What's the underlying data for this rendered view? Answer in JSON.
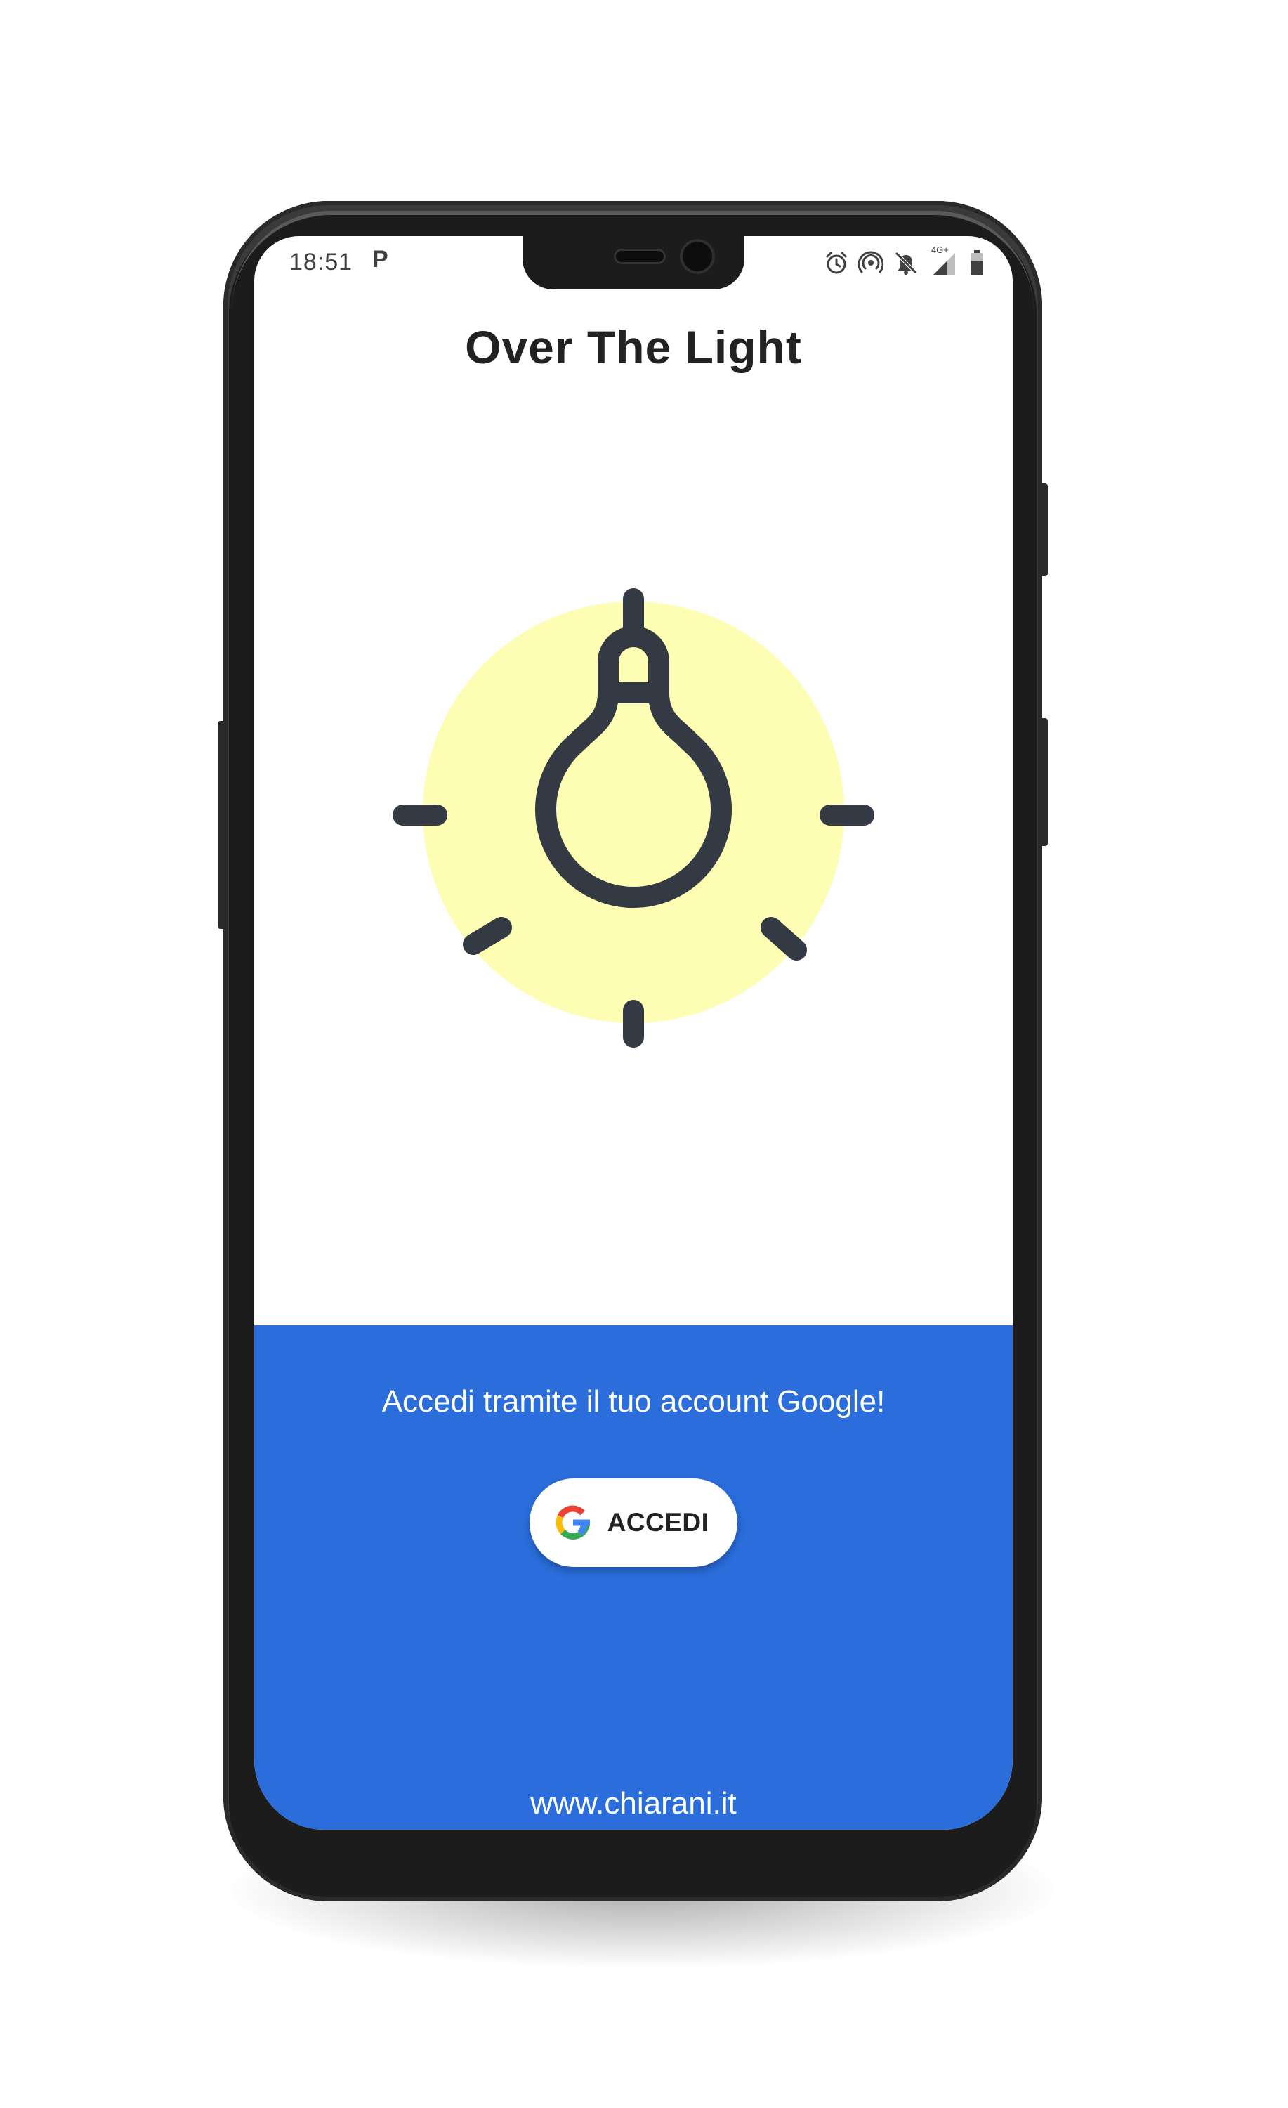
{
  "status_bar": {
    "time": "18:51",
    "notification_app_icon": "P",
    "network_label": "4G+",
    "icons": [
      "alarm-icon",
      "hotspot-icon",
      "bell-off-icon",
      "signal-icon",
      "battery-icon"
    ]
  },
  "app": {
    "title": "Over The Light",
    "hero_icon": "lightbulb-icon",
    "hero_glow_color": "#fdfdb4",
    "icon_color": "#343a44"
  },
  "login": {
    "prompt": "Accedi tramite il tuo account Google!",
    "button_label": "ACCEDI",
    "button_icon": "google-icon",
    "panel_color": "#2a6ddb"
  },
  "footer": {
    "website": "www.chiarani.it"
  }
}
